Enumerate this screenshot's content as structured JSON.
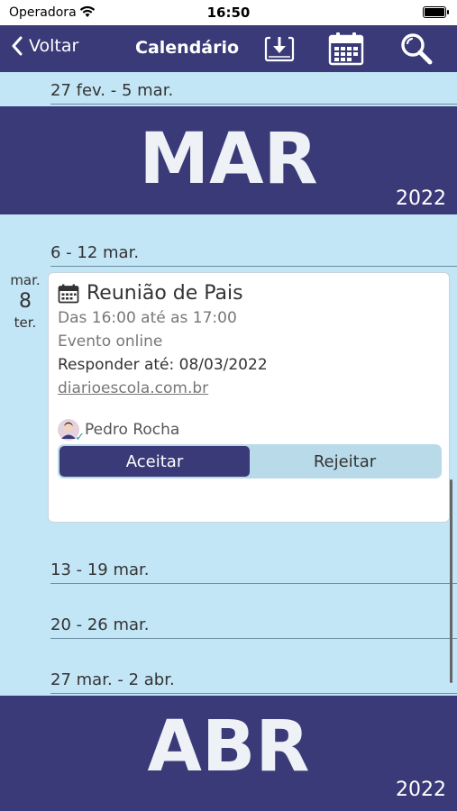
{
  "status_bar": {
    "carrier": "Operadora",
    "time": "16:50"
  },
  "nav": {
    "back_label": "Voltar",
    "title": "Calendário",
    "icons": [
      "download-icon",
      "calendar-icon",
      "search-icon"
    ]
  },
  "weeks": {
    "w1": "27 fev. - 5 mar.",
    "w2": "6 - 12 mar.",
    "w3": "13 - 19 mar.",
    "w4": "20 - 26 mar.",
    "w5": "27 mar. - 2 abr."
  },
  "months": {
    "mar": {
      "label": "MAR",
      "year": "2022"
    },
    "abr": {
      "label": "ABR",
      "year": "2022"
    }
  },
  "day": {
    "month": "mar.",
    "number": "8",
    "weekday": "ter."
  },
  "event": {
    "title": "Reunião de Pais",
    "time": "Das 16:00 até as 17:00",
    "location": "Evento online",
    "respond_by": "Responder até: 08/03/2022",
    "link": "diarioescola.com.br",
    "author": "Pedro Rocha",
    "accept_label": "Aceitar",
    "reject_label": "Rejeitar"
  },
  "colors": {
    "primary": "#3a3a79",
    "background": "#c3e6f6",
    "segment": "#b9dbe9"
  }
}
